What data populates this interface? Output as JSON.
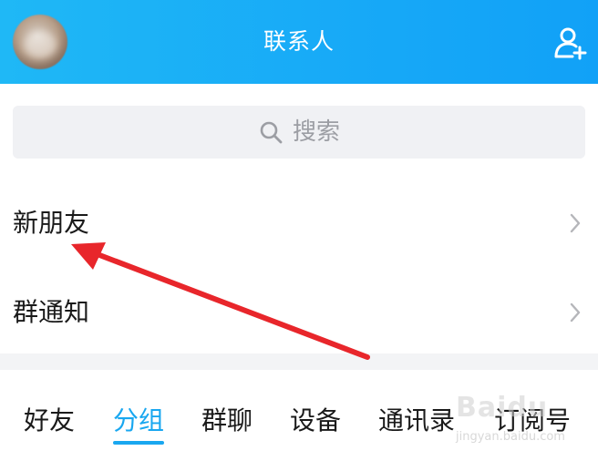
{
  "header": {
    "title": "联系人",
    "avatar_icon": "avatar",
    "add_contact_icon": "add-contact-icon"
  },
  "search": {
    "placeholder": "搜索",
    "icon": "search-icon"
  },
  "rows": [
    {
      "label": "新朋友",
      "icon": "chevron-right-icon"
    },
    {
      "label": "群通知",
      "icon": "chevron-right-icon"
    }
  ],
  "tabs": [
    {
      "label": "好友"
    },
    {
      "label": "分组",
      "active": true
    },
    {
      "label": "群聊"
    },
    {
      "label": "设备"
    },
    {
      "label": "通讯录"
    },
    {
      "label": "订阅号"
    }
  ],
  "annotation": {
    "type": "arrow",
    "color": "#e8262b"
  },
  "watermark": {
    "logo": "Baidu",
    "url": "jingyan.baidu.com"
  },
  "colors": {
    "header": "#17a9f7",
    "accent": "#19a7f0",
    "search_bg": "#f0f1f4",
    "text": "#1a1a1a"
  }
}
